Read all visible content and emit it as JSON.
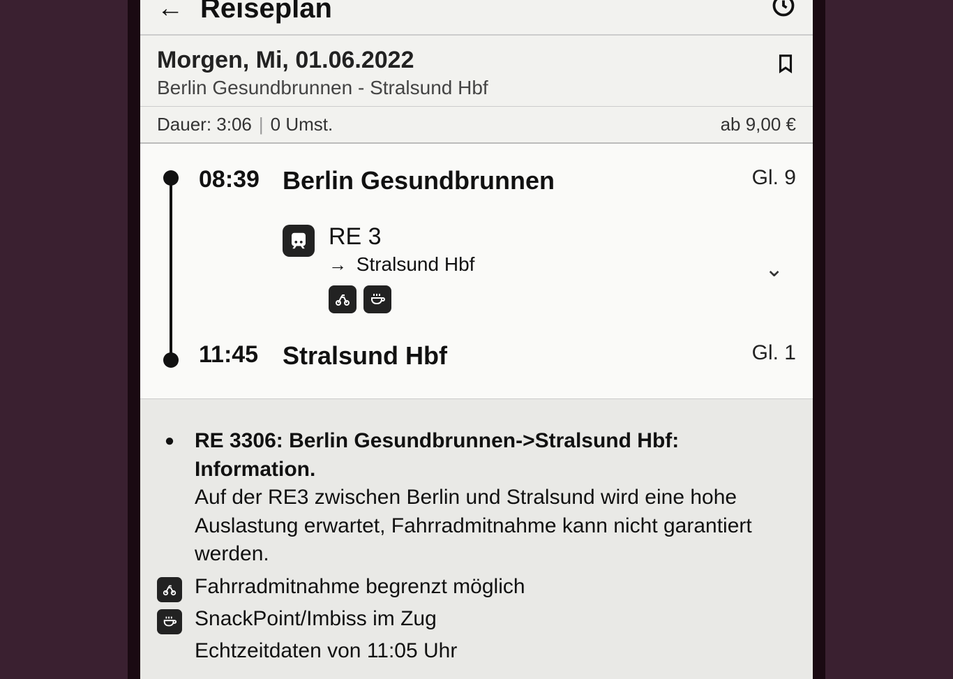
{
  "header": {
    "title": "Reiseplan"
  },
  "summary": {
    "date": "Morgen, Mi, 01.06.2022",
    "route": "Berlin Gesundbrunnen - Stralsund Hbf",
    "duration_label": "Dauer: 3:06",
    "transfers_label": "0 Umst.",
    "price": "ab 9,00 €"
  },
  "journey": {
    "departure": {
      "time": "08:39",
      "station": "Berlin Gesundbrunnen",
      "platform": "Gl. 9"
    },
    "arrival": {
      "time": "11:45",
      "station": "Stralsund Hbf",
      "platform": "Gl. 1"
    },
    "leg": {
      "line": "RE 3",
      "destination_prefix": "→",
      "destination": "Stralsund Hbf",
      "amenities": [
        "bicycle-icon",
        "snack-icon"
      ]
    }
  },
  "info": {
    "title": "RE 3306: Berlin Gesundbrunnen->Stralsund Hbf: Information.",
    "body": "Auf der RE3 zwischen Berlin und Stralsund wird eine hohe Auslastung erwartet, Fahrradmitnahme kann nicht garantiert werden.",
    "bike_note": "Fahrradmitnahme begrenzt möglich",
    "snack_note": "SnackPoint/Imbiss im Zug",
    "realtime_note": "Echtzeitdaten von 11:05 Uhr"
  }
}
